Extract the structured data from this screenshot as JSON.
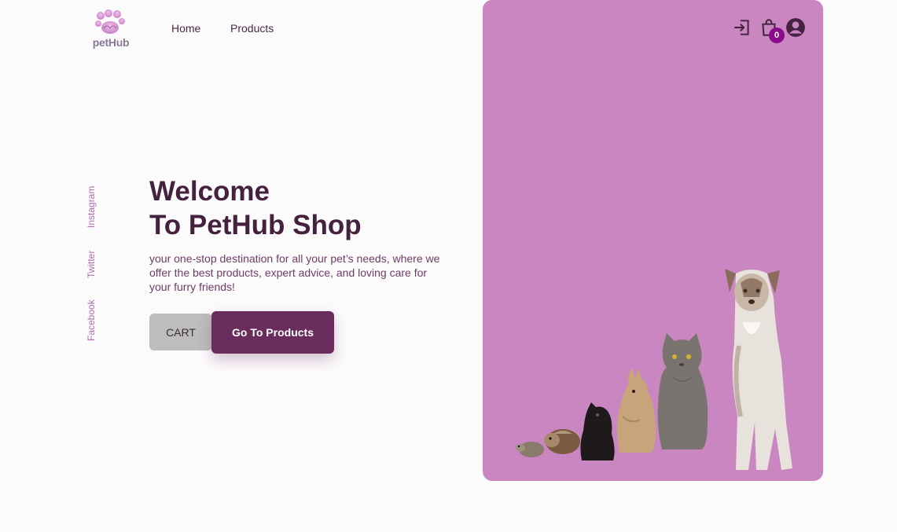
{
  "brand": {
    "name": "petHub"
  },
  "nav": {
    "home": "Home",
    "products": "Products"
  },
  "social": {
    "instagram": "Instagram",
    "twitter": "Twitter",
    "facebook": "Facebook"
  },
  "hero": {
    "title_line1": "Welcome",
    "title_line2": "To PetHub Shop",
    "description": "your one-stop destination for all your pet’s needs, where we offer the best products, expert advice, and loving care for your furry friends!",
    "cart_button": "CART",
    "products_button": "Go To Products"
  },
  "header_icons": {
    "login": "login-icon",
    "cart": "shopping-bag-icon",
    "user": "account-circle-icon"
  },
  "cart": {
    "count": "0"
  },
  "colors": {
    "panel": "#c986c0",
    "primary": "#6a2b5d",
    "title": "#43213f",
    "badge": "#8b0a8b"
  }
}
